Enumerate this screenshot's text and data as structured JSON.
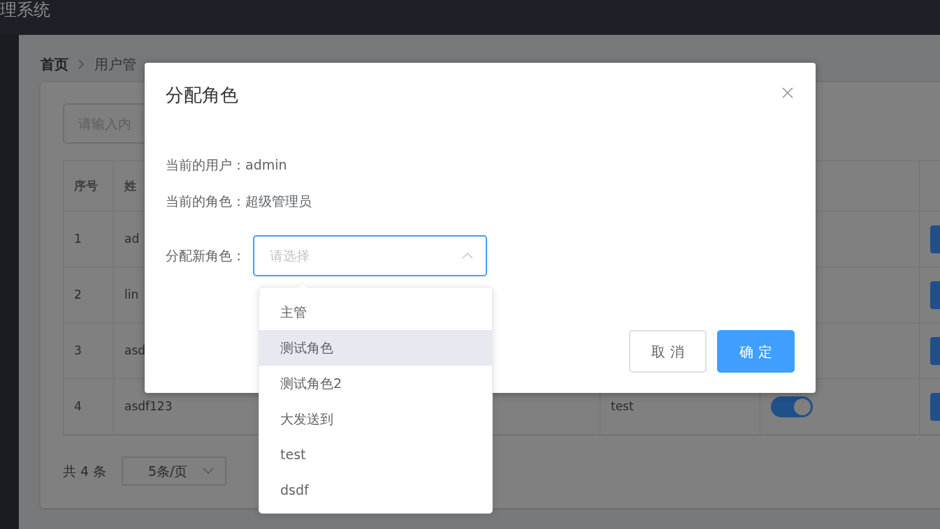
{
  "header": {
    "title": "理系统"
  },
  "breadcrumb": [
    "首页",
    "用户管"
  ],
  "search": {
    "placeholder": "请输入内"
  },
  "table": {
    "columns": [
      "序号",
      "姓"
    ],
    "rows": [
      {
        "index": "1",
        "name": "ad"
      },
      {
        "index": "2",
        "name": "lin"
      },
      {
        "index": "3",
        "name": "asd"
      },
      {
        "index": "4",
        "name": "asdf123",
        "role": "test",
        "enabled": true
      }
    ]
  },
  "pagination": {
    "total": "共 4 条",
    "page_size": "5条/页"
  },
  "dialog": {
    "title": "分配角色",
    "current_user": "当前的用户：admin",
    "current_role": "当前的角色：超级管理员",
    "new_role_label": "分配新角色：",
    "select": {
      "placeholder": "请选择",
      "open": true
    },
    "options": [
      {
        "label": "主管",
        "hovered": false
      },
      {
        "label": "测试角色",
        "hovered": true
      },
      {
        "label": "测试角色2",
        "hovered": false
      },
      {
        "label": "大发送到",
        "hovered": false
      },
      {
        "label": "test",
        "hovered": false
      },
      {
        "label": "dsdf",
        "hovered": false
      }
    ],
    "buttons": [
      {
        "label": "取 消",
        "kind": "secondary"
      },
      {
        "label": "确 定",
        "kind": "primary"
      }
    ]
  }
}
